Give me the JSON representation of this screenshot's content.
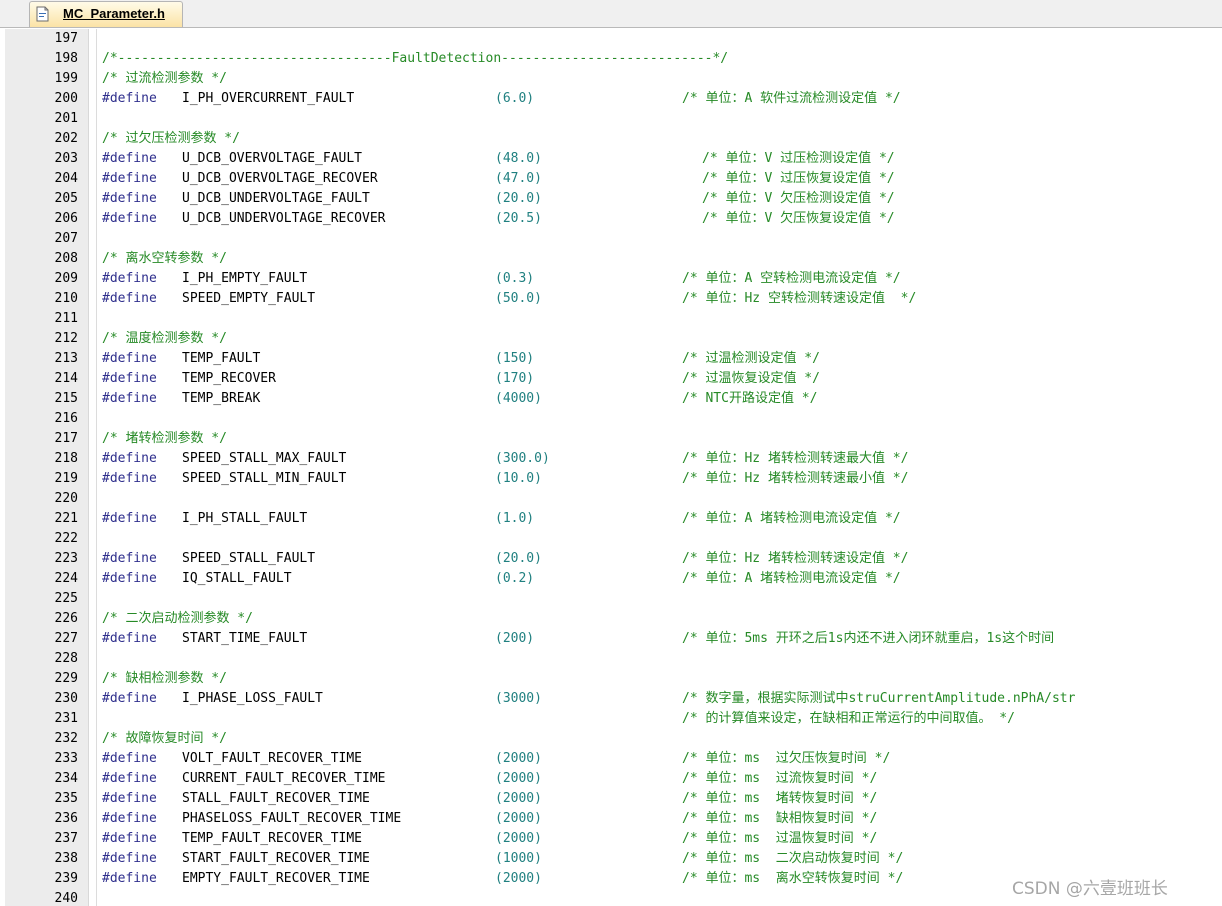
{
  "tab": {
    "label": "MC_Parameter.h",
    "icon": "header-file-icon"
  },
  "colors": {
    "keyword": "#2e2e8c",
    "number": "#208080",
    "comment": "#268a26",
    "gutter_bg": "#ececec",
    "tab_bg": "#fbe3a6"
  },
  "code_lines": [
    {
      "num": "197",
      "kind": "blank"
    },
    {
      "num": "198",
      "kind": "comment",
      "text": "/*-----------------------------------FaultDetection---------------------------*/"
    },
    {
      "num": "199",
      "kind": "comment",
      "text": "/* 过流检测参数 */"
    },
    {
      "num": "200",
      "kind": "define",
      "directive": "#define",
      "name": "I_PH_OVERCURRENT_FAULT",
      "value": "(6.0)",
      "comment": "/* 单位：A 软件过流检测设定值 */"
    },
    {
      "num": "201",
      "kind": "blank"
    },
    {
      "num": "202",
      "kind": "comment",
      "text": "/* 过欠压检测参数 */"
    },
    {
      "num": "203",
      "kind": "define",
      "directive": "#define",
      "name": "U_DCB_OVERVOLTAGE_FAULT",
      "value": "(48.0)",
      "comment": "/* 单位：V 过压检测设定值 */",
      "indent": "wide"
    },
    {
      "num": "204",
      "kind": "define",
      "directive": "#define",
      "name": "U_DCB_OVERVOLTAGE_RECOVER",
      "value": "(47.0)",
      "comment": "/* 单位：V 过压恢复设定值 */",
      "indent": "wide"
    },
    {
      "num": "205",
      "kind": "define",
      "directive": "#define",
      "name": "U_DCB_UNDERVOLTAGE_FAULT",
      "value": "(20.0)",
      "comment": "/* 单位：V 欠压检测设定值 */",
      "indent": "wide"
    },
    {
      "num": "206",
      "kind": "define",
      "directive": "#define",
      "name": "U_DCB_UNDERVOLTAGE_RECOVER",
      "value": "(20.5)",
      "comment": "/* 单位：V 欠压恢复设定值 */",
      "indent": "wide"
    },
    {
      "num": "207",
      "kind": "blank"
    },
    {
      "num": "208",
      "kind": "comment",
      "text": "/* 离水空转参数 */"
    },
    {
      "num": "209",
      "kind": "define",
      "directive": "#define",
      "name": "I_PH_EMPTY_FAULT",
      "value": "(0.3)",
      "comment": "/* 单位：A 空转检测电流设定值 */"
    },
    {
      "num": "210",
      "kind": "define",
      "directive": "#define",
      "name": "SPEED_EMPTY_FAULT",
      "value": "(50.0)",
      "comment": "/* 单位：Hz 空转检测转速设定值  */"
    },
    {
      "num": "211",
      "kind": "blank"
    },
    {
      "num": "212",
      "kind": "comment",
      "text": "/* 温度检测参数 */"
    },
    {
      "num": "213",
      "kind": "define",
      "directive": "#define",
      "name": "TEMP_FAULT",
      "value": "(150)",
      "comment": "/* 过温检测设定值 */"
    },
    {
      "num": "214",
      "kind": "define",
      "directive": "#define",
      "name": "TEMP_RECOVER",
      "value": "(170)",
      "comment": "/* 过温恢复设定值 */"
    },
    {
      "num": "215",
      "kind": "define",
      "directive": "#define",
      "name": "TEMP_BREAK",
      "value": "(4000)",
      "comment": "/* NTC开路设定值 */"
    },
    {
      "num": "216",
      "kind": "blank"
    },
    {
      "num": "217",
      "kind": "comment",
      "text": "/* 堵转检测参数 */"
    },
    {
      "num": "218",
      "kind": "define",
      "directive": "#define",
      "name": "SPEED_STALL_MAX_FAULT",
      "value": "(300.0)",
      "comment": "/* 单位：Hz 堵转检测转速最大值 */"
    },
    {
      "num": "219",
      "kind": "define",
      "directive": "#define",
      "name": "SPEED_STALL_MIN_FAULT",
      "value": "(10.0)",
      "comment": "/* 单位：Hz 堵转检测转速最小值 */"
    },
    {
      "num": "220",
      "kind": "blank"
    },
    {
      "num": "221",
      "kind": "define",
      "directive": "#define",
      "name": "I_PH_STALL_FAULT",
      "value": "(1.0)",
      "comment": "/* 单位：A 堵转检测电流设定值 */"
    },
    {
      "num": "222",
      "kind": "blank"
    },
    {
      "num": "223",
      "kind": "define",
      "directive": "#define",
      "name": "SPEED_STALL_FAULT",
      "value": "(20.0)",
      "comment": "/* 单位：Hz 堵转检测转速设定值 */"
    },
    {
      "num": "224",
      "kind": "define",
      "directive": "#define",
      "name": "IQ_STALL_FAULT",
      "value": "(0.2)",
      "comment": "/* 单位：A 堵转检测电流设定值 */"
    },
    {
      "num": "225",
      "kind": "blank"
    },
    {
      "num": "226",
      "kind": "comment",
      "text": "/* 二次启动检测参数 */"
    },
    {
      "num": "227",
      "kind": "define",
      "directive": "#define",
      "name": "START_TIME_FAULT",
      "value": "(200)",
      "comment": "/* 单位：5ms 开环之后1s内还不进入闭环就重启，1s这个时间"
    },
    {
      "num": "228",
      "kind": "blank"
    },
    {
      "num": "229",
      "kind": "comment",
      "text": "/* 缺相检测参数 */"
    },
    {
      "num": "230",
      "kind": "define",
      "directive": "#define",
      "name": "I_PHASE_LOSS_FAULT",
      "value": "(3000)",
      "comment": "/* 数字量，根据实际测试中struCurrentAmplitude.nPhA/str"
    },
    {
      "num": "231",
      "kind": "continuation",
      "comment": "/* 的计算值来设定，在缺相和正常运行的中间取值。 */"
    },
    {
      "num": "232",
      "kind": "comment",
      "text": "/* 故障恢复时间 */"
    },
    {
      "num": "233",
      "kind": "define",
      "directive": "#define",
      "name": "VOLT_FAULT_RECOVER_TIME",
      "value": "(2000)",
      "comment": "/* 单位：ms  过欠压恢复时间 */"
    },
    {
      "num": "234",
      "kind": "define",
      "directive": "#define",
      "name": "CURRENT_FAULT_RECOVER_TIME",
      "value": "(2000)",
      "comment": "/* 单位：ms  过流恢复时间 */"
    },
    {
      "num": "235",
      "kind": "define",
      "directive": "#define",
      "name": "STALL_FAULT_RECOVER_TIME",
      "value": "(2000)",
      "comment": "/* 单位：ms  堵转恢复时间 */"
    },
    {
      "num": "236",
      "kind": "define",
      "directive": "#define",
      "name": "PHASELOSS_FAULT_RECOVER_TIME",
      "value": "(2000)",
      "comment": "/* 单位：ms  缺相恢复时间 */"
    },
    {
      "num": "237",
      "kind": "define",
      "directive": "#define",
      "name": "TEMP_FAULT_RECOVER_TIME",
      "value": "(2000)",
      "comment": "/* 单位：ms  过温恢复时间 */"
    },
    {
      "num": "238",
      "kind": "define",
      "directive": "#define",
      "name": "START_FAULT_RECOVER_TIME",
      "value": "(1000)",
      "comment": "/* 单位：ms  二次启动恢复时间 */"
    },
    {
      "num": "239",
      "kind": "define",
      "directive": "#define",
      "name": "EMPTY_FAULT_RECOVER_TIME",
      "value": "(2000)",
      "comment": "/* 单位：ms  离水空转恢复时间 */"
    },
    {
      "num": "240",
      "kind": "blank"
    }
  ],
  "watermark": "CSDN @六壹班班长"
}
